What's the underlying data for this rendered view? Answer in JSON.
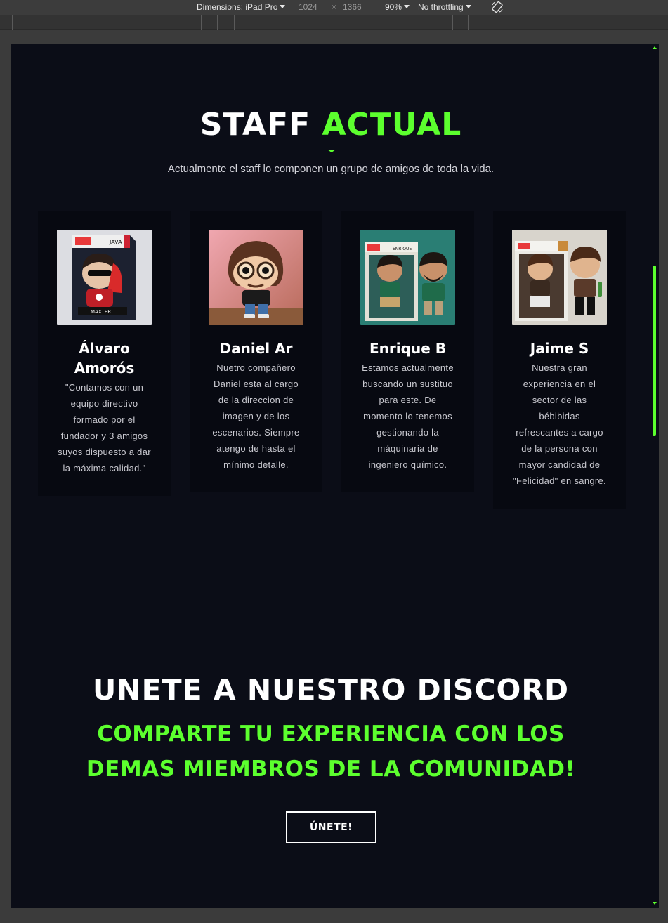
{
  "devtools": {
    "dimensions_label": "Dimensions: iPad Pro",
    "width": "1024",
    "times": "×",
    "height": "1366",
    "zoom": "90%",
    "throttling": "No throttling"
  },
  "staff": {
    "title_white": "STAFF",
    "title_accent": "ACTUAL",
    "subtitle": "Actualmente el staff lo componen un grupo de amigos de toda la vida.",
    "members": [
      {
        "name": "Álvaro Amorós",
        "bio": "\"Contamos con un equipo directivo formado por el fundador y 3 amigos suyos dispuesto a dar la máxima calidad.\"",
        "photo_alt": "funko-pop-java-maxter"
      },
      {
        "name": "Daniel Ar",
        "bio": "Nuetro compañero Daniel esta al cargo de la direccion de imagen y de los escenarios. Siempre atengo de hasta el mínimo detalle.",
        "photo_alt": "funko-figure-glasses"
      },
      {
        "name": "Enrique B",
        "bio": "Estamos actualmente buscando un sustituo para este. De momento lo tenemos gestionando la máquinaria de ingeniero químico.",
        "photo_alt": "funko-pop-enrique"
      },
      {
        "name": "Jaime S",
        "bio": "Nuestra gran experiencia en el sector de las bébibidas refrescantes a cargo de la persona con mayor candidad de \"Felicidad\" en sangre.",
        "photo_alt": "funko-pop-jaime"
      }
    ]
  },
  "discord": {
    "title": "UNETE A NUESTRO DISCORD",
    "subtitle": "COMPARTE TU EXPERIENCIA CON LOS DEMAS MIEMBROS DE LA COMUNIDAD!",
    "button_label": "ÚNETE!"
  },
  "colors": {
    "accent": "#5cff2e",
    "background": "#0b0d17",
    "card": "#070911"
  }
}
